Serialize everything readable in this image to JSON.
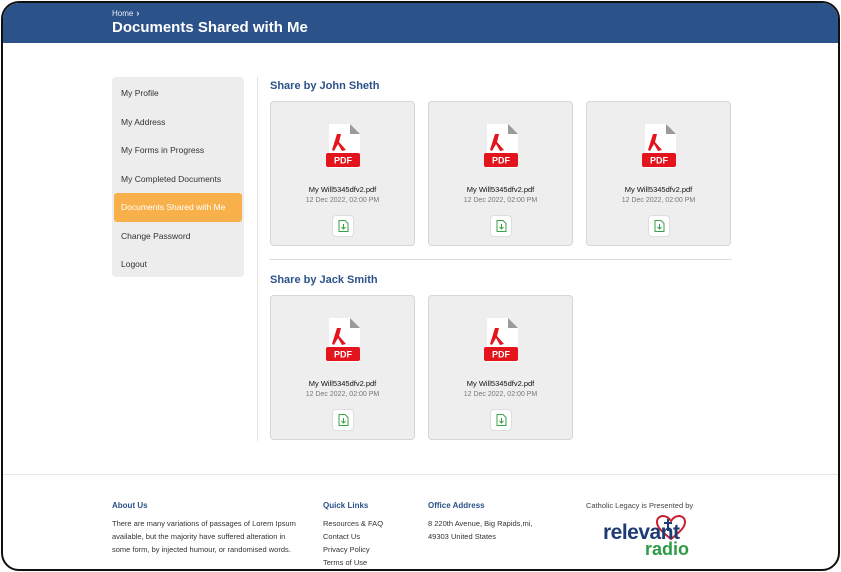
{
  "header": {
    "breadcrumb_home": "Home",
    "breadcrumb_sep": "›",
    "title": "Documents Shared with Me",
    "bg_color": "#2b5289"
  },
  "sidebar": {
    "items": [
      {
        "label": "My Profile",
        "active": false
      },
      {
        "label": "My Address",
        "active": false
      },
      {
        "label": "My Forms in Progress",
        "active": false
      },
      {
        "label": "My Completed Documents",
        "active": false
      },
      {
        "label": "Documents Shared with Me",
        "active": true
      },
      {
        "label": "Change Password",
        "active": false
      },
      {
        "label": "Logout",
        "active": false
      }
    ],
    "active_color": "#f7b04a"
  },
  "sections": [
    {
      "title": "Share by John Sheth",
      "documents": [
        {
          "badge": "PDF",
          "name": "My Will5345dfv2.pdf",
          "date": "12 Dec 2022, 02:00 PM"
        },
        {
          "badge": "PDF",
          "name": "My Will5345dfv2.pdf",
          "date": "12 Dec 2022, 02:00 PM"
        },
        {
          "badge": "PDF",
          "name": "My Will5345dfv2.pdf",
          "date": "12 Dec 2022, 02:00 PM"
        }
      ]
    },
    {
      "title": "Share by Jack Smith",
      "documents": [
        {
          "badge": "PDF",
          "name": "My Will5345dfv2.pdf",
          "date": "12 Dec 2022, 02:00 PM"
        },
        {
          "badge": "PDF",
          "name": "My Will5345dfv2.pdf",
          "date": "12 Dec 2022, 02:00 PM"
        }
      ]
    }
  ],
  "footer": {
    "about": {
      "heading": "About Us",
      "text": "There are many variations of passages of Lorem Ipsum available, but the majority have suffered alteration in some form, by injected humour, or randomised words."
    },
    "quick_links": {
      "heading": "Quick Links",
      "links": [
        "Resources & FAQ",
        "Contact Us",
        "Privacy Policy",
        "Terms of Use"
      ]
    },
    "office": {
      "heading": "Office Address",
      "line1": "8 220th Avenue, Big Rapids,mi,",
      "line2": "49303  United States"
    },
    "presented_by": "Catholic Legacy is Presented by",
    "logo_word1": "relevant",
    "logo_word2": "radio"
  },
  "icons": {
    "pdf": "pdf-file-icon",
    "download": "download-file-icon",
    "logo_heart": "heart-cross-icon"
  },
  "colors": {
    "accent_blue": "#2b5289",
    "pdf_red": "#e3141b",
    "download_green": "#3aa04a",
    "logo_blue": "#1f3b73",
    "logo_green": "#2e9a46",
    "logo_red": "#c8202e"
  }
}
